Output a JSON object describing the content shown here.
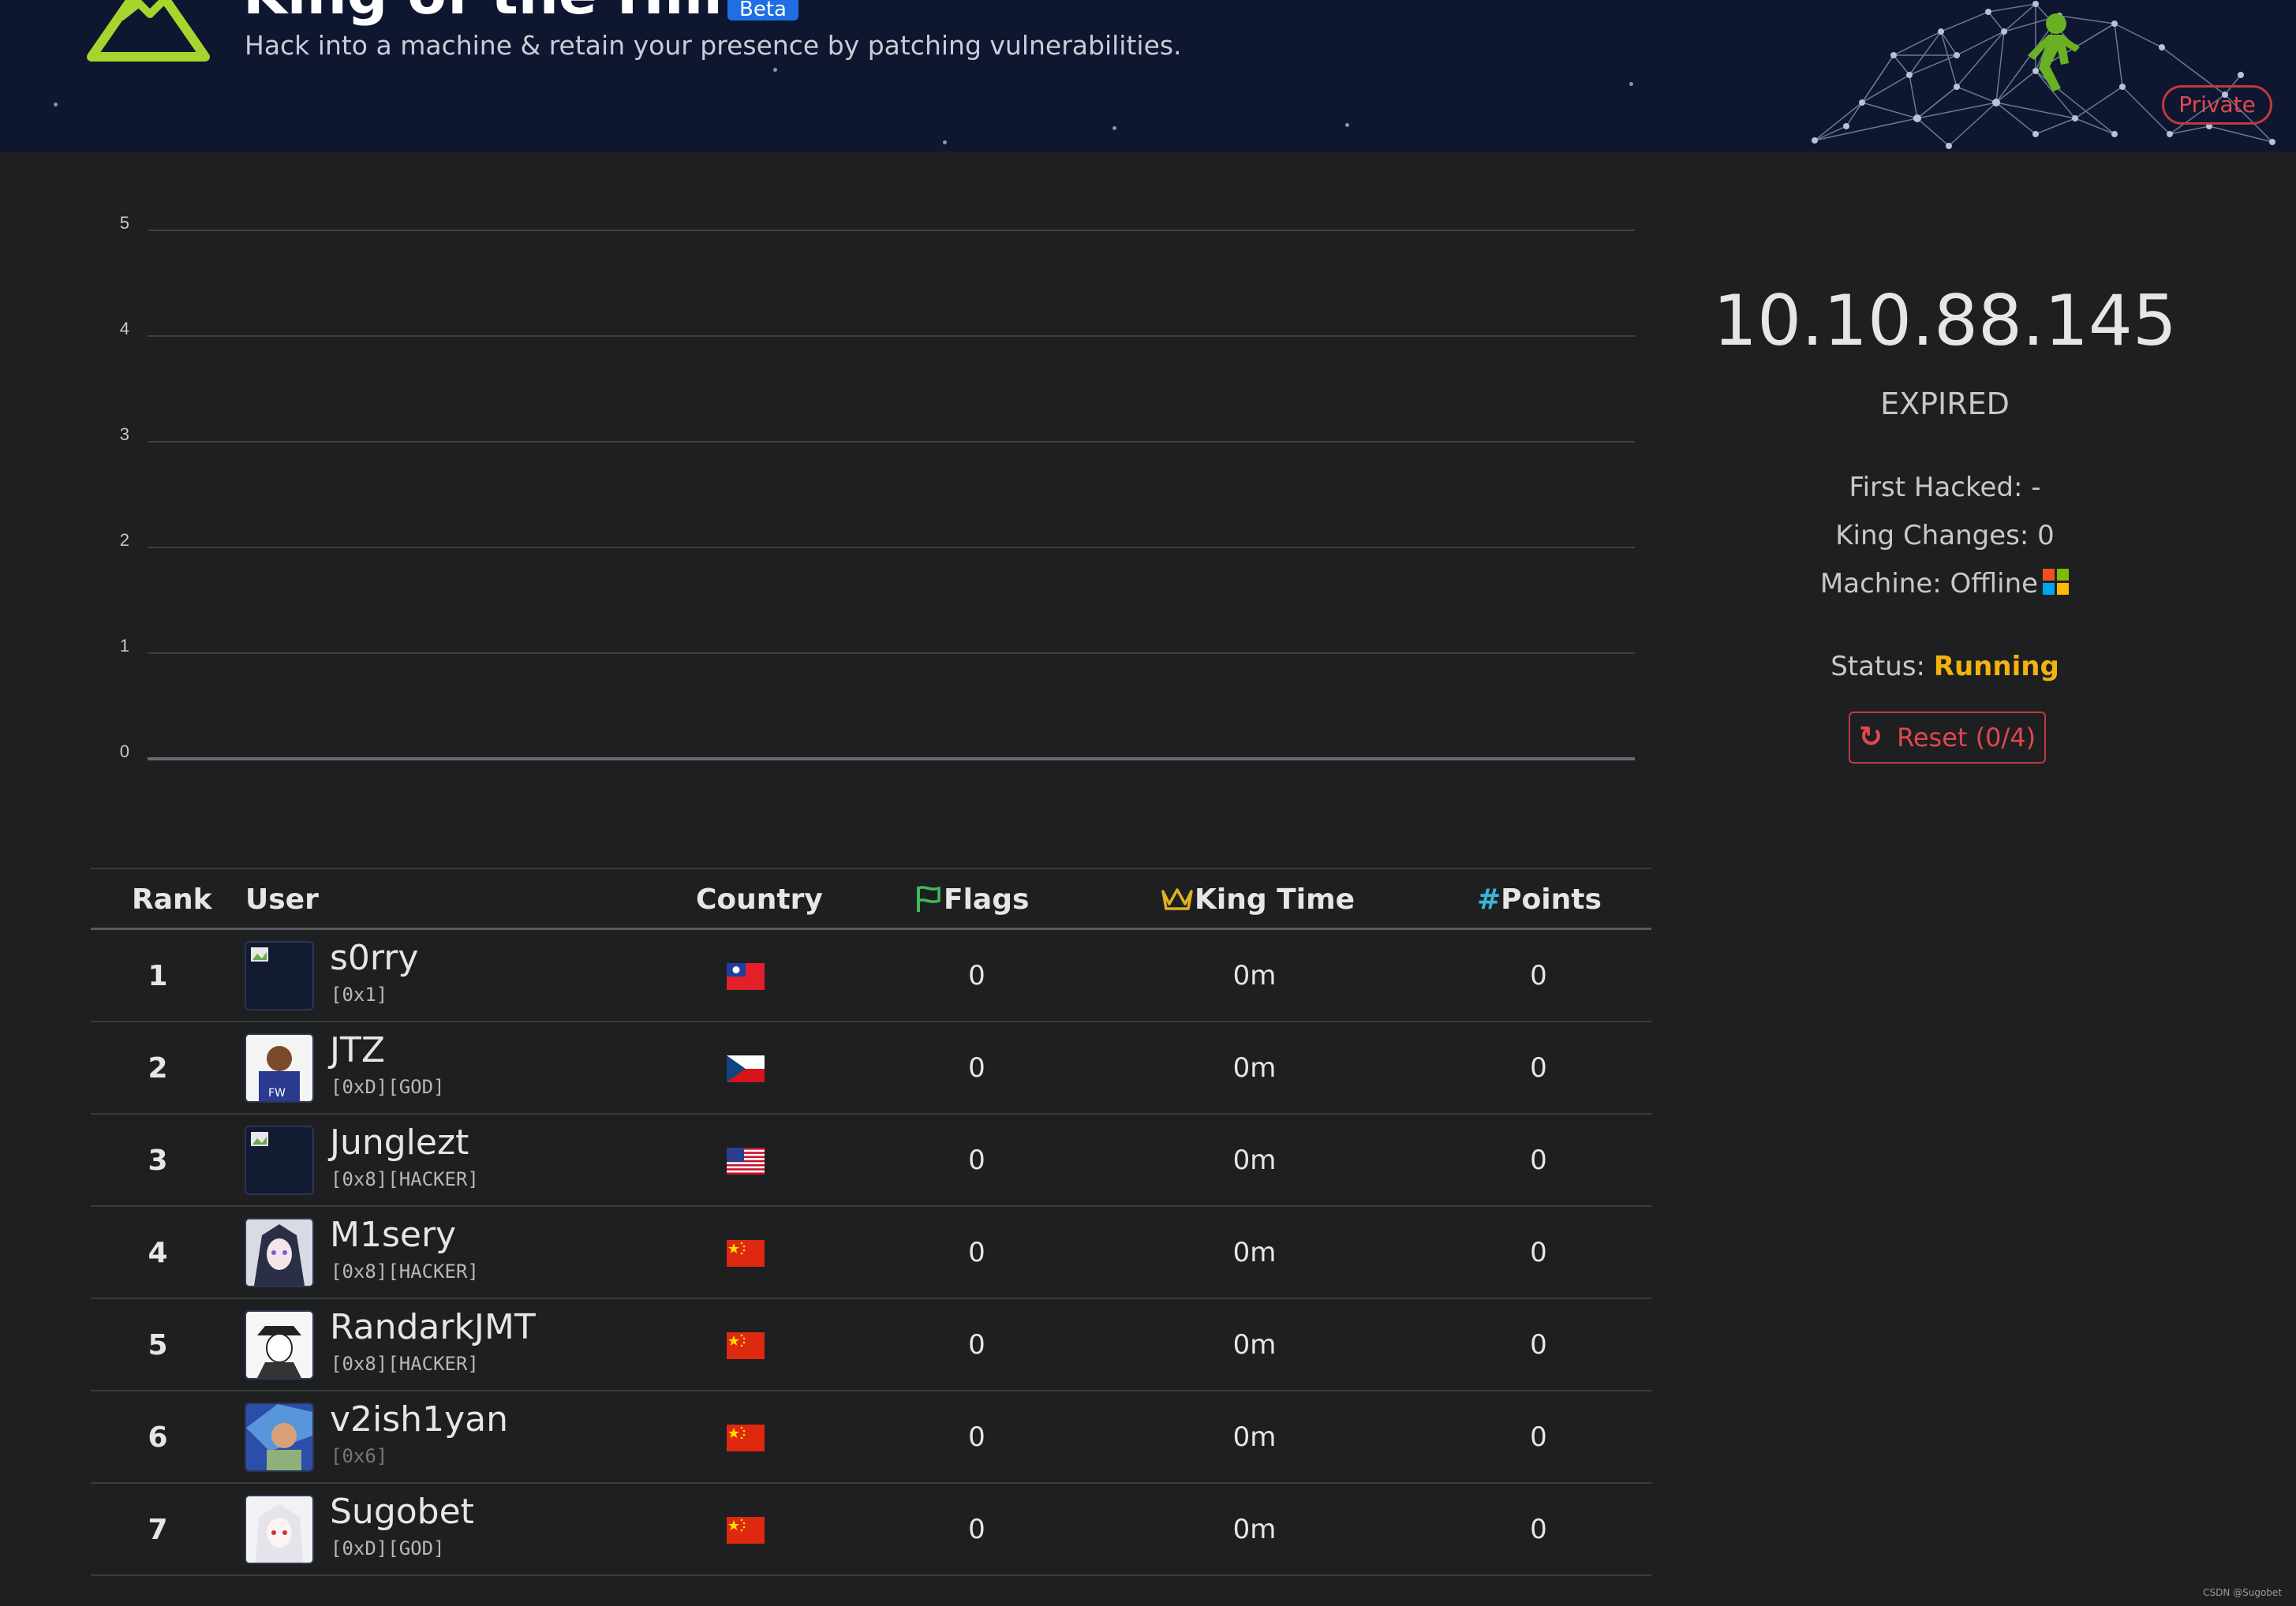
{
  "header": {
    "title": "King of the Hill",
    "badge": "Beta",
    "subtitle": "Hack into a machine & retain your presence by patching vulnerabilities.",
    "private_label": "Private"
  },
  "chart_data": {
    "type": "line",
    "title": "",
    "xlabel": "",
    "ylabel": "",
    "ylim": [
      0,
      5
    ],
    "yticks": [
      "0",
      "1",
      "2",
      "3",
      "4",
      "5"
    ],
    "grid": true,
    "series": []
  },
  "machine": {
    "ip": "10.10.88.145",
    "state": "EXPIRED",
    "first_hacked": "First Hacked: -",
    "king_changes": "King Changes: 0",
    "machine_status": "Machine: Offline",
    "os_icon": "windows-icon",
    "status_label": "Status:",
    "status_value": "Running",
    "reset_label": "Reset (0/4)"
  },
  "table": {
    "headers": {
      "rank": "Rank",
      "user": "User",
      "country": "Country",
      "flags": "Flags",
      "king_time": "King Time",
      "points": "Points"
    },
    "rows": [
      {
        "rank": "1",
        "user": "s0rry",
        "level": "[0x1]",
        "country": "taiwan",
        "flags": "0",
        "king_time": "0m",
        "points": "0"
      },
      {
        "rank": "2",
        "user": "JTZ",
        "level": "[0xD][GOD]",
        "country": "czechia",
        "flags": "0",
        "king_time": "0m",
        "points": "0"
      },
      {
        "rank": "3",
        "user": "Junglezt",
        "level": "[0x8][HACKER]",
        "country": "united-states",
        "flags": "0",
        "king_time": "0m",
        "points": "0"
      },
      {
        "rank": "4",
        "user": "M1sery",
        "level": "[0x8][HACKER]",
        "country": "china",
        "flags": "0",
        "king_time": "0m",
        "points": "0"
      },
      {
        "rank": "5",
        "user": "RandarkJMT",
        "level": "[0x8][HACKER]",
        "country": "china",
        "flags": "0",
        "king_time": "0m",
        "points": "0"
      },
      {
        "rank": "6",
        "user": "v2ish1yan",
        "level": "[0x6]",
        "country": "china",
        "flags": "0",
        "king_time": "0m",
        "points": "0"
      },
      {
        "rank": "7",
        "user": "Sugobet",
        "level": "[0xD][GOD]",
        "country": "china",
        "flags": "0",
        "king_time": "0m",
        "points": "0"
      }
    ]
  },
  "colors": {
    "accent_green": "#a6d62e",
    "status_yellow": "#f3b20e",
    "danger_red": "#e0484d",
    "flag_green": "#3dbb5a",
    "crown_yellow": "#e0b020",
    "hash_cyan": "#3ab5d8"
  },
  "watermark": "CSDN @Sugobet"
}
